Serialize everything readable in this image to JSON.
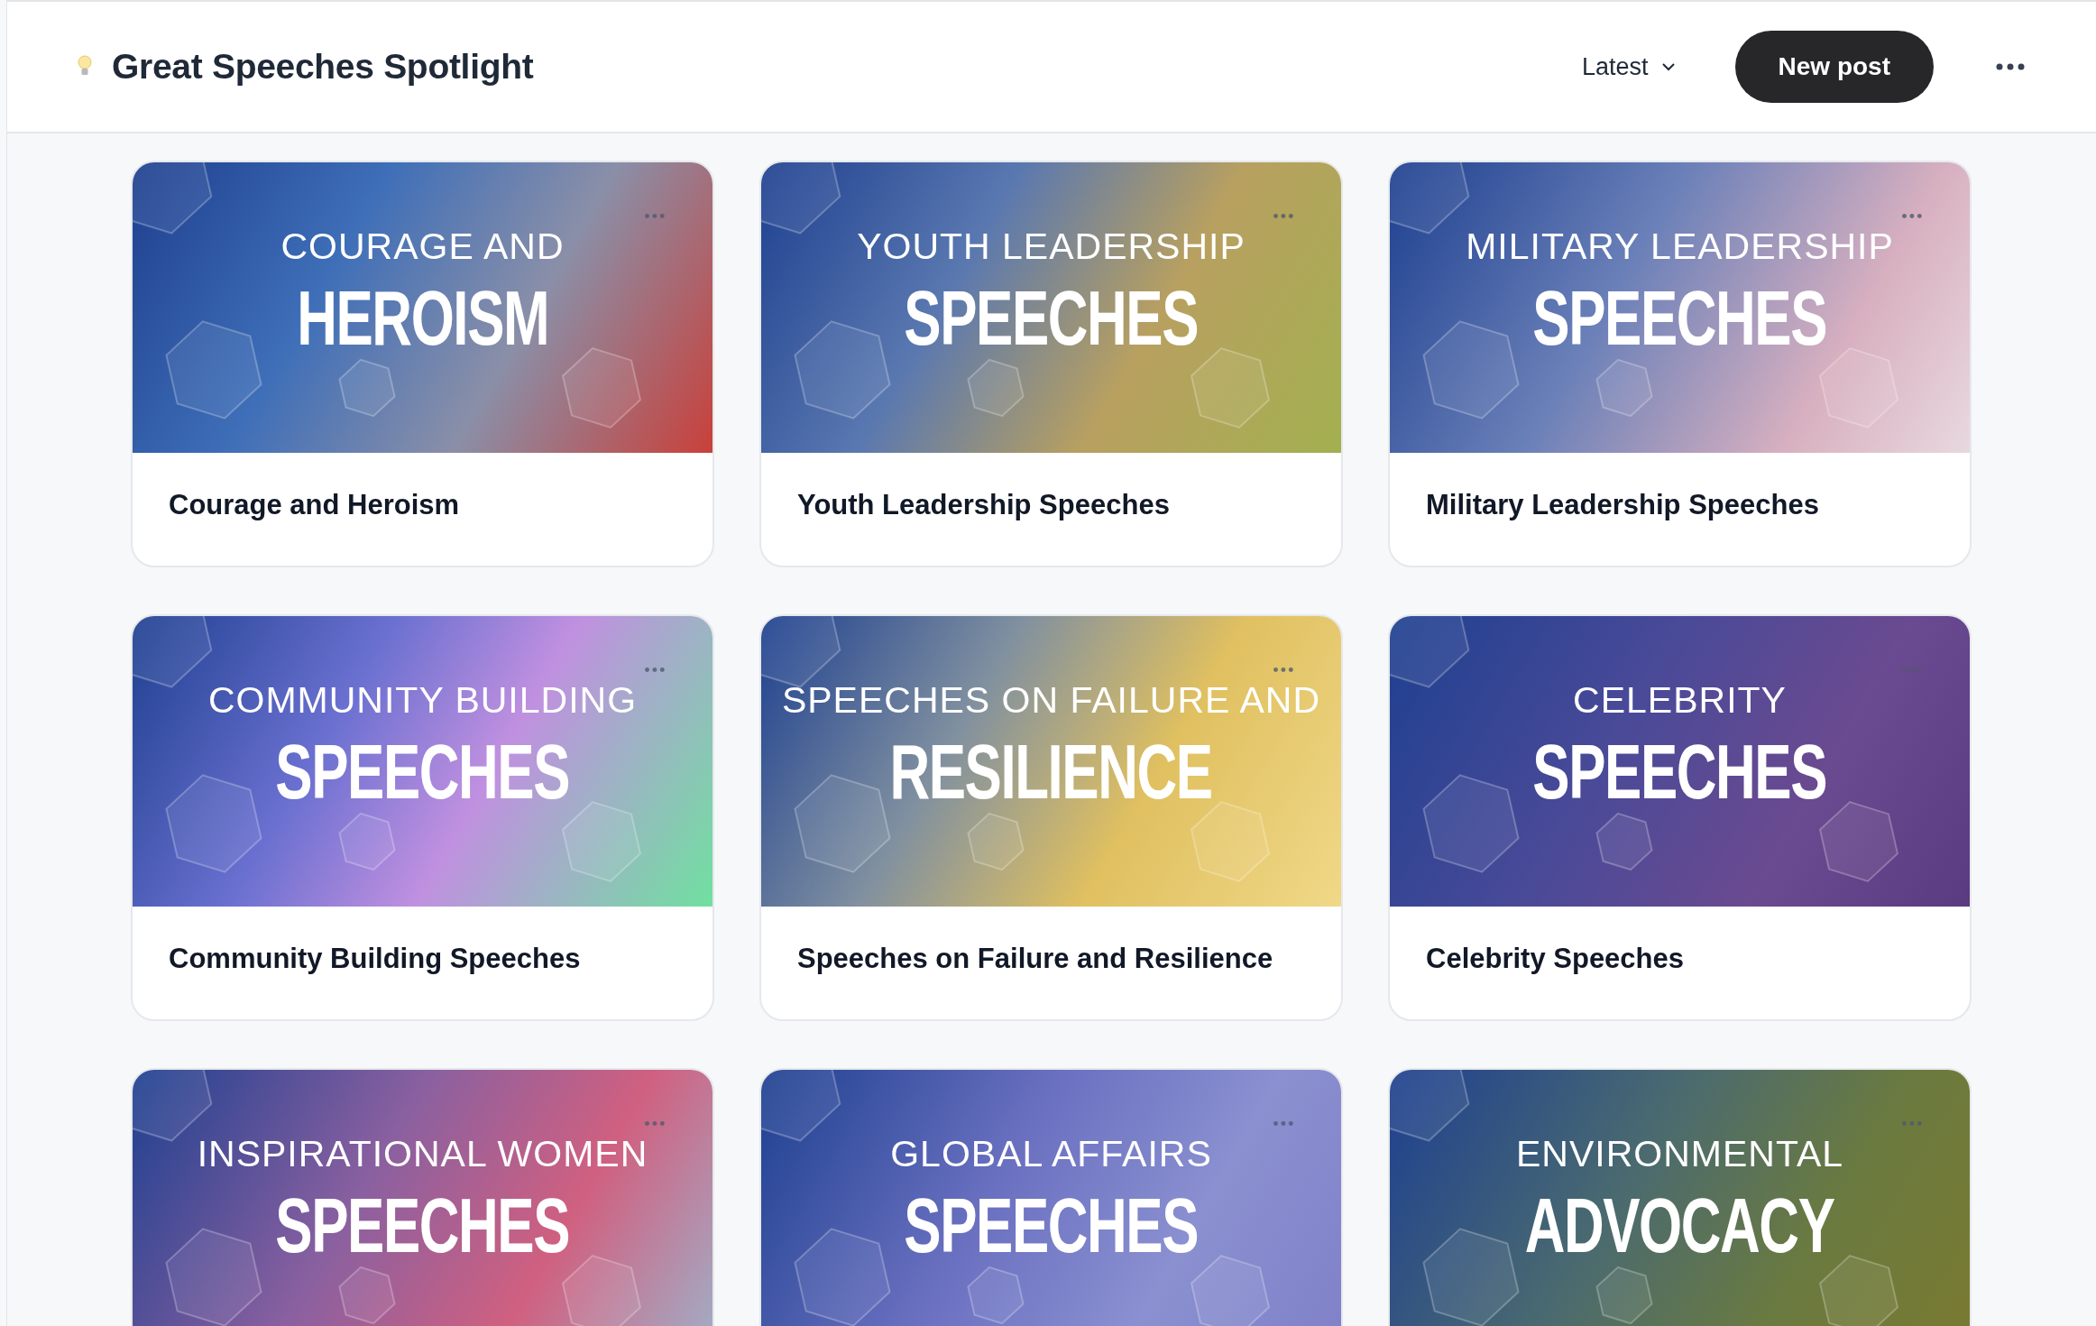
{
  "header": {
    "title": "Great Speeches Spotlight",
    "sort": {
      "label": "Latest"
    },
    "new_post": "New post"
  },
  "cards": [
    {
      "banner_top": "COURAGE AND",
      "banner_main": "HEROISM",
      "title": "Courage and Heroism"
    },
    {
      "banner_top": "YOUTH LEADERSHIP",
      "banner_main": "SPEECHES",
      "title": "Youth Leadership Speeches"
    },
    {
      "banner_top": "MILITARY LEADERSHIP",
      "banner_main": "SPEECHES",
      "title": "Military Leadership Speeches"
    },
    {
      "banner_top": "COMMUNITY BUILDING",
      "banner_main": "SPEECHES",
      "title": "Community Building Speeches"
    },
    {
      "banner_top": "SPEECHES ON FAILURE AND",
      "banner_main": "RESILIENCE",
      "title": "Speeches on Failure and Resilience"
    },
    {
      "banner_top": "CELEBRITY",
      "banner_main": "SPEECHES",
      "title": "Celebrity Speeches"
    },
    {
      "banner_top": "INSPIRATIONAL WOMEN",
      "banner_main": "SPEECHES"
    },
    {
      "banner_top": "GLOBAL AFFAIRS",
      "banner_main": "SPEECHES"
    },
    {
      "banner_top": "ENVIRONMENTAL",
      "banner_main": "ADVOCACY"
    }
  ]
}
